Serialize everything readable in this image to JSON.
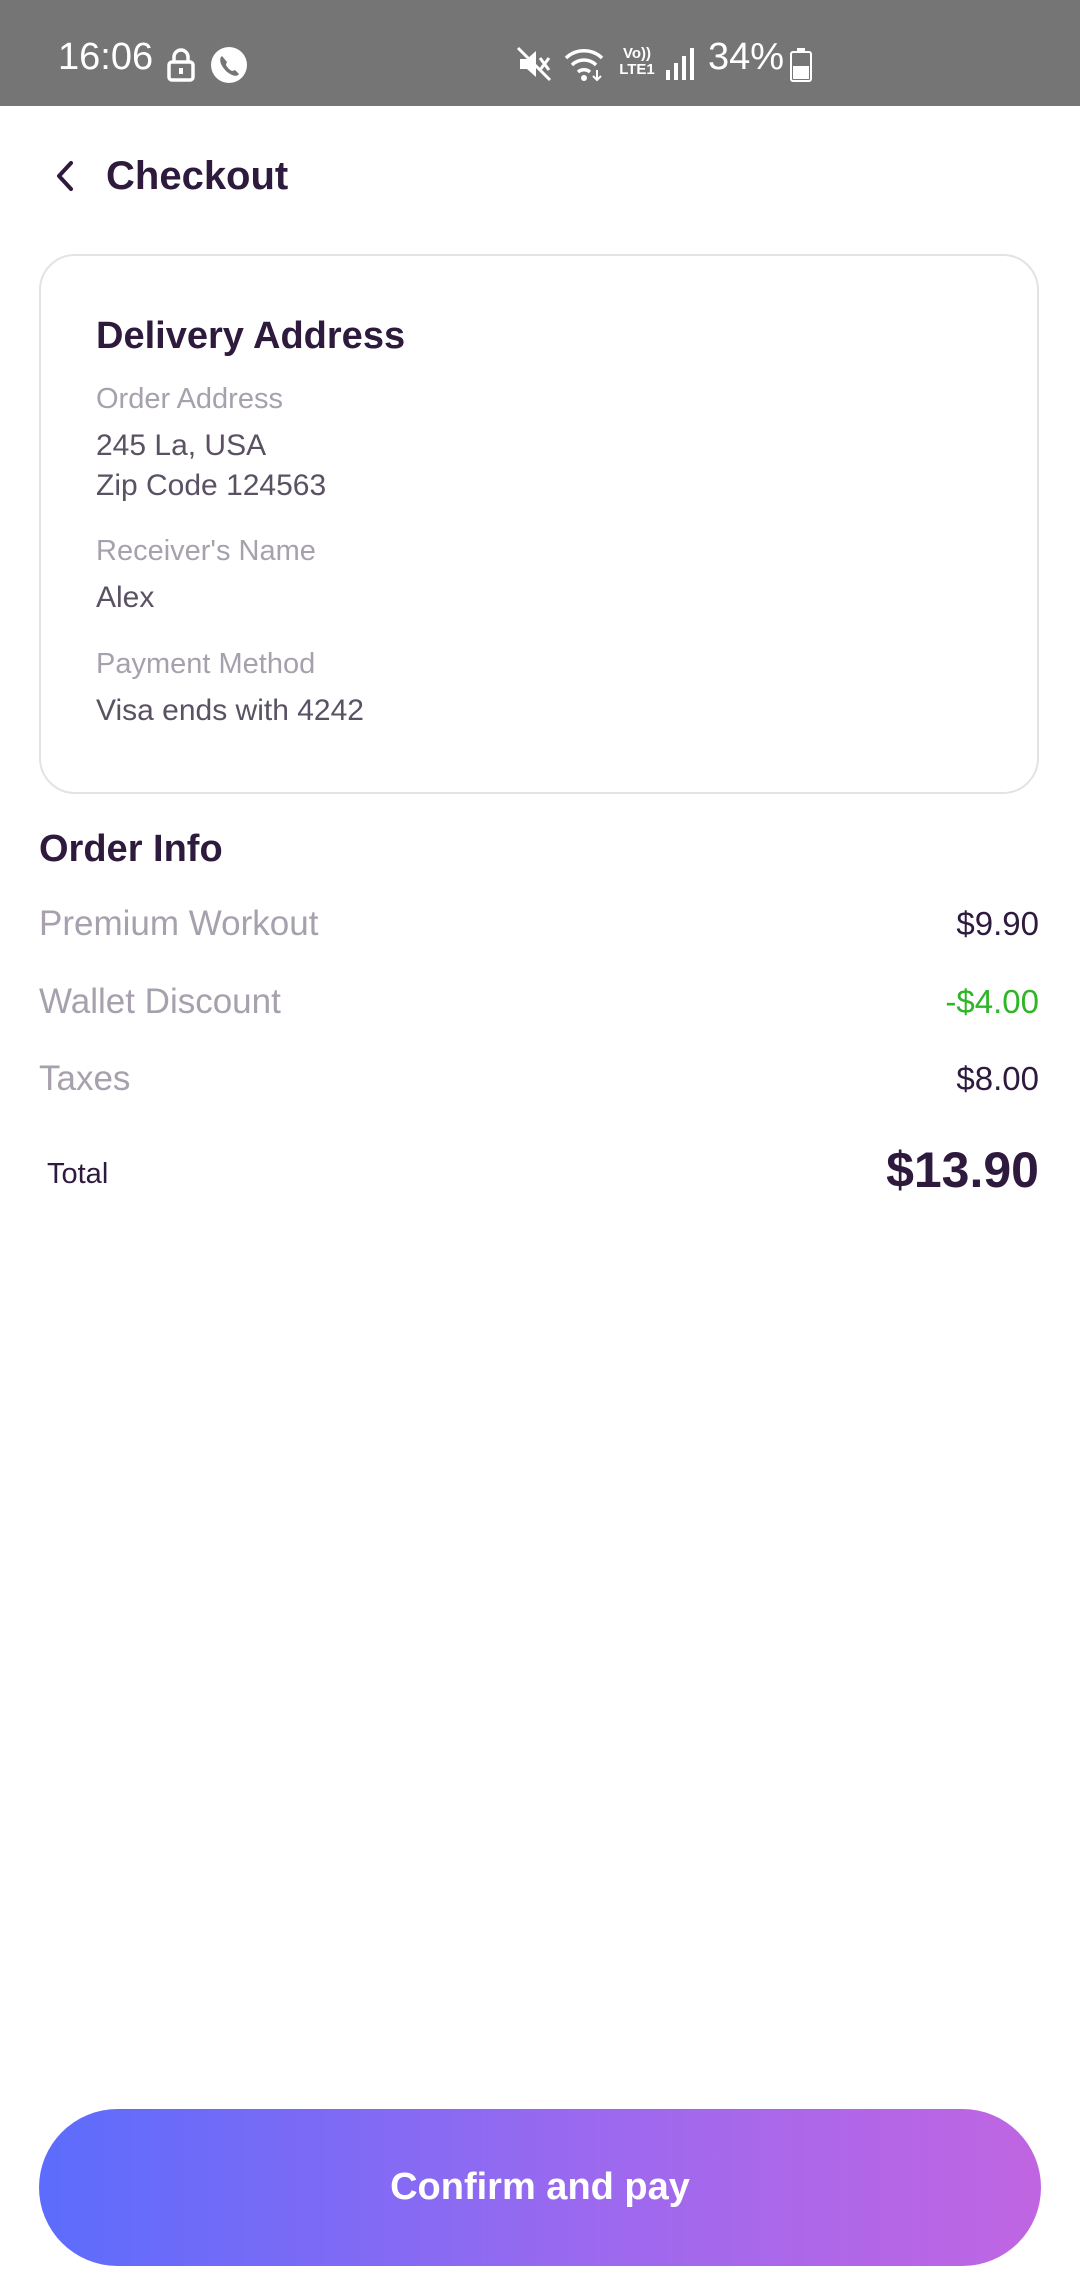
{
  "status_bar": {
    "time": "16:06",
    "battery": "34%",
    "network_label": "Vo)) LTE1",
    "icons": [
      "lock-icon",
      "call-icon",
      "mute-icon",
      "wifi-icon",
      "lte-icon",
      "signal-icon",
      "battery-icon"
    ]
  },
  "header": {
    "back_icon": "chevron-left-icon",
    "title": "Checkout"
  },
  "delivery": {
    "title": "Delivery Address",
    "order_address_label": "Order Address",
    "order_address_line1": "245 La, USA",
    "order_address_line2": "Zip Code 124563",
    "receiver_label": "Receiver's Name",
    "receiver_value": "Alex",
    "payment_label": "Payment Method",
    "payment_value": "Visa ends with 4242"
  },
  "order_info": {
    "title": "Order Info",
    "rows": [
      {
        "label": "Premium Workout",
        "value": "$9.90"
      },
      {
        "label": "Wallet Discount",
        "value": "-$4.00"
      },
      {
        "label": "Taxes",
        "value": "$8.00"
      }
    ],
    "total_label": "Total",
    "total_value": "$13.90"
  },
  "confirm_button": {
    "label": "Confirm and pay"
  },
  "colors": {
    "primary_text": "#2e1a3d",
    "muted_text": "#a6a1ad",
    "discount": "#2fb527",
    "gradient_start": "#5c6cfc",
    "gradient_end": "#c065e2",
    "status_bar": "#757575"
  }
}
